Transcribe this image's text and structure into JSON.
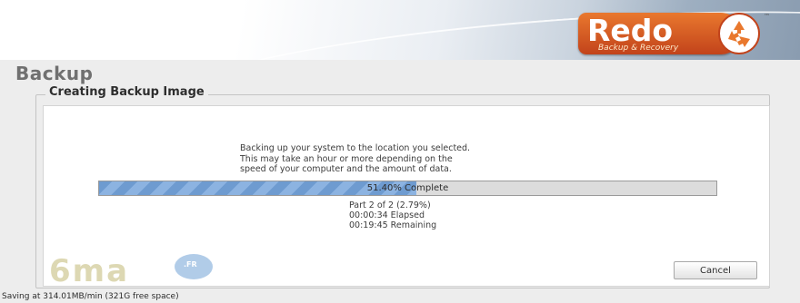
{
  "logo": {
    "wordmark": "Redo",
    "tagline": "Backup & Recovery",
    "trademark": "™"
  },
  "page": {
    "title": "Backup",
    "section_title": "Creating Backup Image"
  },
  "message": {
    "lines": [
      "Backing up your system to the location you selected.",
      "This may take an hour or more depending on the",
      "speed of your computer and the amount of data."
    ]
  },
  "progress": {
    "fraction": 0.514,
    "label": "51.40% Complete"
  },
  "stats": {
    "part": "Part 2 of 2 (2.79%)",
    "elapsed": "00:00:34 Elapsed",
    "remaining": "00:19:45 Remaining"
  },
  "buttons": {
    "cancel_label": "Cancel"
  },
  "watermark": {
    "text": "6ma",
    "badge": ".FR"
  },
  "status_bar": {
    "text": "Saving at 314.01MB/min (321G free space)"
  },
  "colors": {
    "progress_fill": "#6e9bd0",
    "logo_orange": "#e9782e"
  },
  "icons": {
    "logo_emblem": "recycle-icon"
  }
}
